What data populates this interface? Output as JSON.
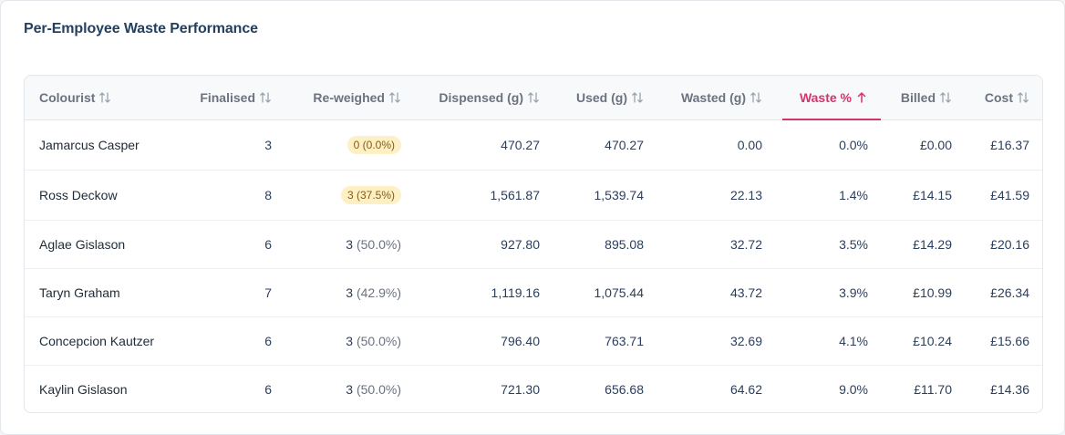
{
  "card": {
    "title": "Per-Employee Waste Performance"
  },
  "table": {
    "headers": {
      "colourist": "Colourist",
      "finalised": "Finalised",
      "reweighed": "Re-weighed",
      "dispensed": "Dispensed (g)",
      "used": "Used (g)",
      "wasted": "Wasted (g)",
      "waste_pct": "Waste %",
      "billed": "Billed",
      "cost": "Cost"
    },
    "sorted_column": "Waste %",
    "sort_direction": "ascending",
    "colors": {
      "accent": "#d6336c",
      "badge_bg": "#fdf0c5",
      "badge_text": "#8a5a0a"
    },
    "rows": [
      {
        "colourist": "Jamarcus Casper",
        "finalised": "3",
        "rw_count": "0",
        "rw_pct": "(0.0%)",
        "rw_highlight": true,
        "dispensed": "470.27",
        "used": "470.27",
        "wasted": "0.00",
        "waste_pct": "0.0%",
        "billed": "£0.00",
        "cost": "£16.37"
      },
      {
        "colourist": "Ross Deckow",
        "finalised": "8",
        "rw_count": "3",
        "rw_pct": "(37.5%)",
        "rw_highlight": true,
        "dispensed": "1,561.87",
        "used": "1,539.74",
        "wasted": "22.13",
        "waste_pct": "1.4%",
        "billed": "£14.15",
        "cost": "£41.59"
      },
      {
        "colourist": "Aglae Gislason",
        "finalised": "6",
        "rw_count": "3",
        "rw_pct": "(50.0%)",
        "rw_highlight": false,
        "dispensed": "927.80",
        "used": "895.08",
        "wasted": "32.72",
        "waste_pct": "3.5%",
        "billed": "£14.29",
        "cost": "£20.16"
      },
      {
        "colourist": "Taryn Graham",
        "finalised": "7",
        "rw_count": "3",
        "rw_pct": "(42.9%)",
        "rw_highlight": false,
        "dispensed": "1,119.16",
        "used": "1,075.44",
        "wasted": "43.72",
        "waste_pct": "3.9%",
        "billed": "£10.99",
        "cost": "£26.34"
      },
      {
        "colourist": "Concepcion Kautzer",
        "finalised": "6",
        "rw_count": "3",
        "rw_pct": "(50.0%)",
        "rw_highlight": false,
        "dispensed": "796.40",
        "used": "763.71",
        "wasted": "32.69",
        "waste_pct": "4.1%",
        "billed": "£10.24",
        "cost": "£15.66"
      },
      {
        "colourist": "Kaylin Gislason",
        "finalised": "6",
        "rw_count": "3",
        "rw_pct": "(50.0%)",
        "rw_highlight": false,
        "dispensed": "721.30",
        "used": "656.68",
        "wasted": "64.62",
        "waste_pct": "9.0%",
        "billed": "£11.70",
        "cost": "£14.36"
      }
    ]
  }
}
